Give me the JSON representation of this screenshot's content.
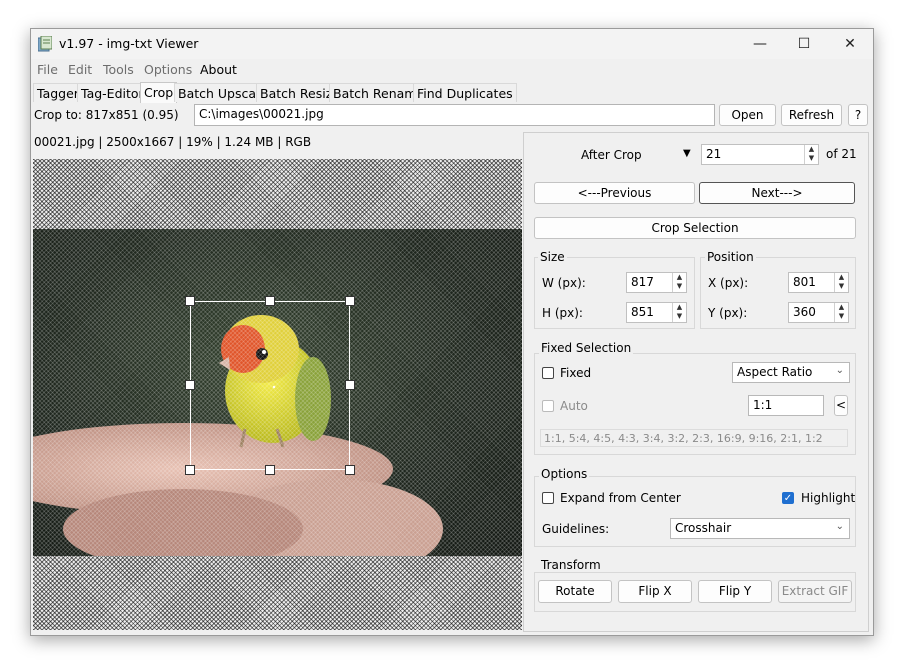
{
  "window": {
    "title": "v1.97 - img-txt Viewer",
    "controls": {
      "minimize": "—",
      "maximize": "☐",
      "close": "✕"
    }
  },
  "menu": [
    "File",
    "Edit",
    "Tools",
    "Options",
    "About"
  ],
  "tabs": [
    "Tagger",
    "Tag-Editor",
    "Crop",
    "Batch Upscale",
    "Batch Resize",
    "Batch Rename",
    "Find Duplicates"
  ],
  "toolbar": {
    "crop_to": "Crop to: 817x851 (0.95)",
    "path": "C:\\images\\00021.jpg",
    "open": "Open",
    "refresh": "Refresh",
    "help": "?"
  },
  "image_info": "00021.jpg  |  2500x1667  |  19%  |  1.24 MB  |  RGB",
  "nav": {
    "mode": "After Crop",
    "index": "21",
    "of_total": "of 21",
    "previous": "<---Previous",
    "next": "Next--->"
  },
  "crop_selection_button": "Crop Selection",
  "size": {
    "title": "Size",
    "w_label": "W (px):",
    "w_value": "817",
    "h_label": "H (px):",
    "h_value": "851"
  },
  "position": {
    "title": "Position",
    "x_label": "X (px):",
    "x_value": "801",
    "y_label": "Y (px):",
    "y_value": "360"
  },
  "fixed_selection": {
    "title": "Fixed Selection",
    "fixed_label": "Fixed",
    "mode": "Aspect Ratio",
    "auto_label": "Auto",
    "ratio": "1:1",
    "ratio_button": "<",
    "presets": "1:1, 5:4, 4:5, 4:3, 3:4, 3:2, 2:3, 16:9, 9:16, 2:1, 1:2"
  },
  "options": {
    "title": "Options",
    "expand_label": "Expand from Center",
    "highlight_label": "Highlight",
    "guidelines_label": "Guidelines:",
    "guidelines_value": "Crosshair"
  },
  "transform": {
    "title": "Transform",
    "rotate": "Rotate",
    "flip_x": "Flip X",
    "flip_y": "Flip Y",
    "extract_gif": "Extract GIF"
  },
  "colors": {
    "accent": "#1f6fd0",
    "window_bg": "#f0f0f0"
  }
}
